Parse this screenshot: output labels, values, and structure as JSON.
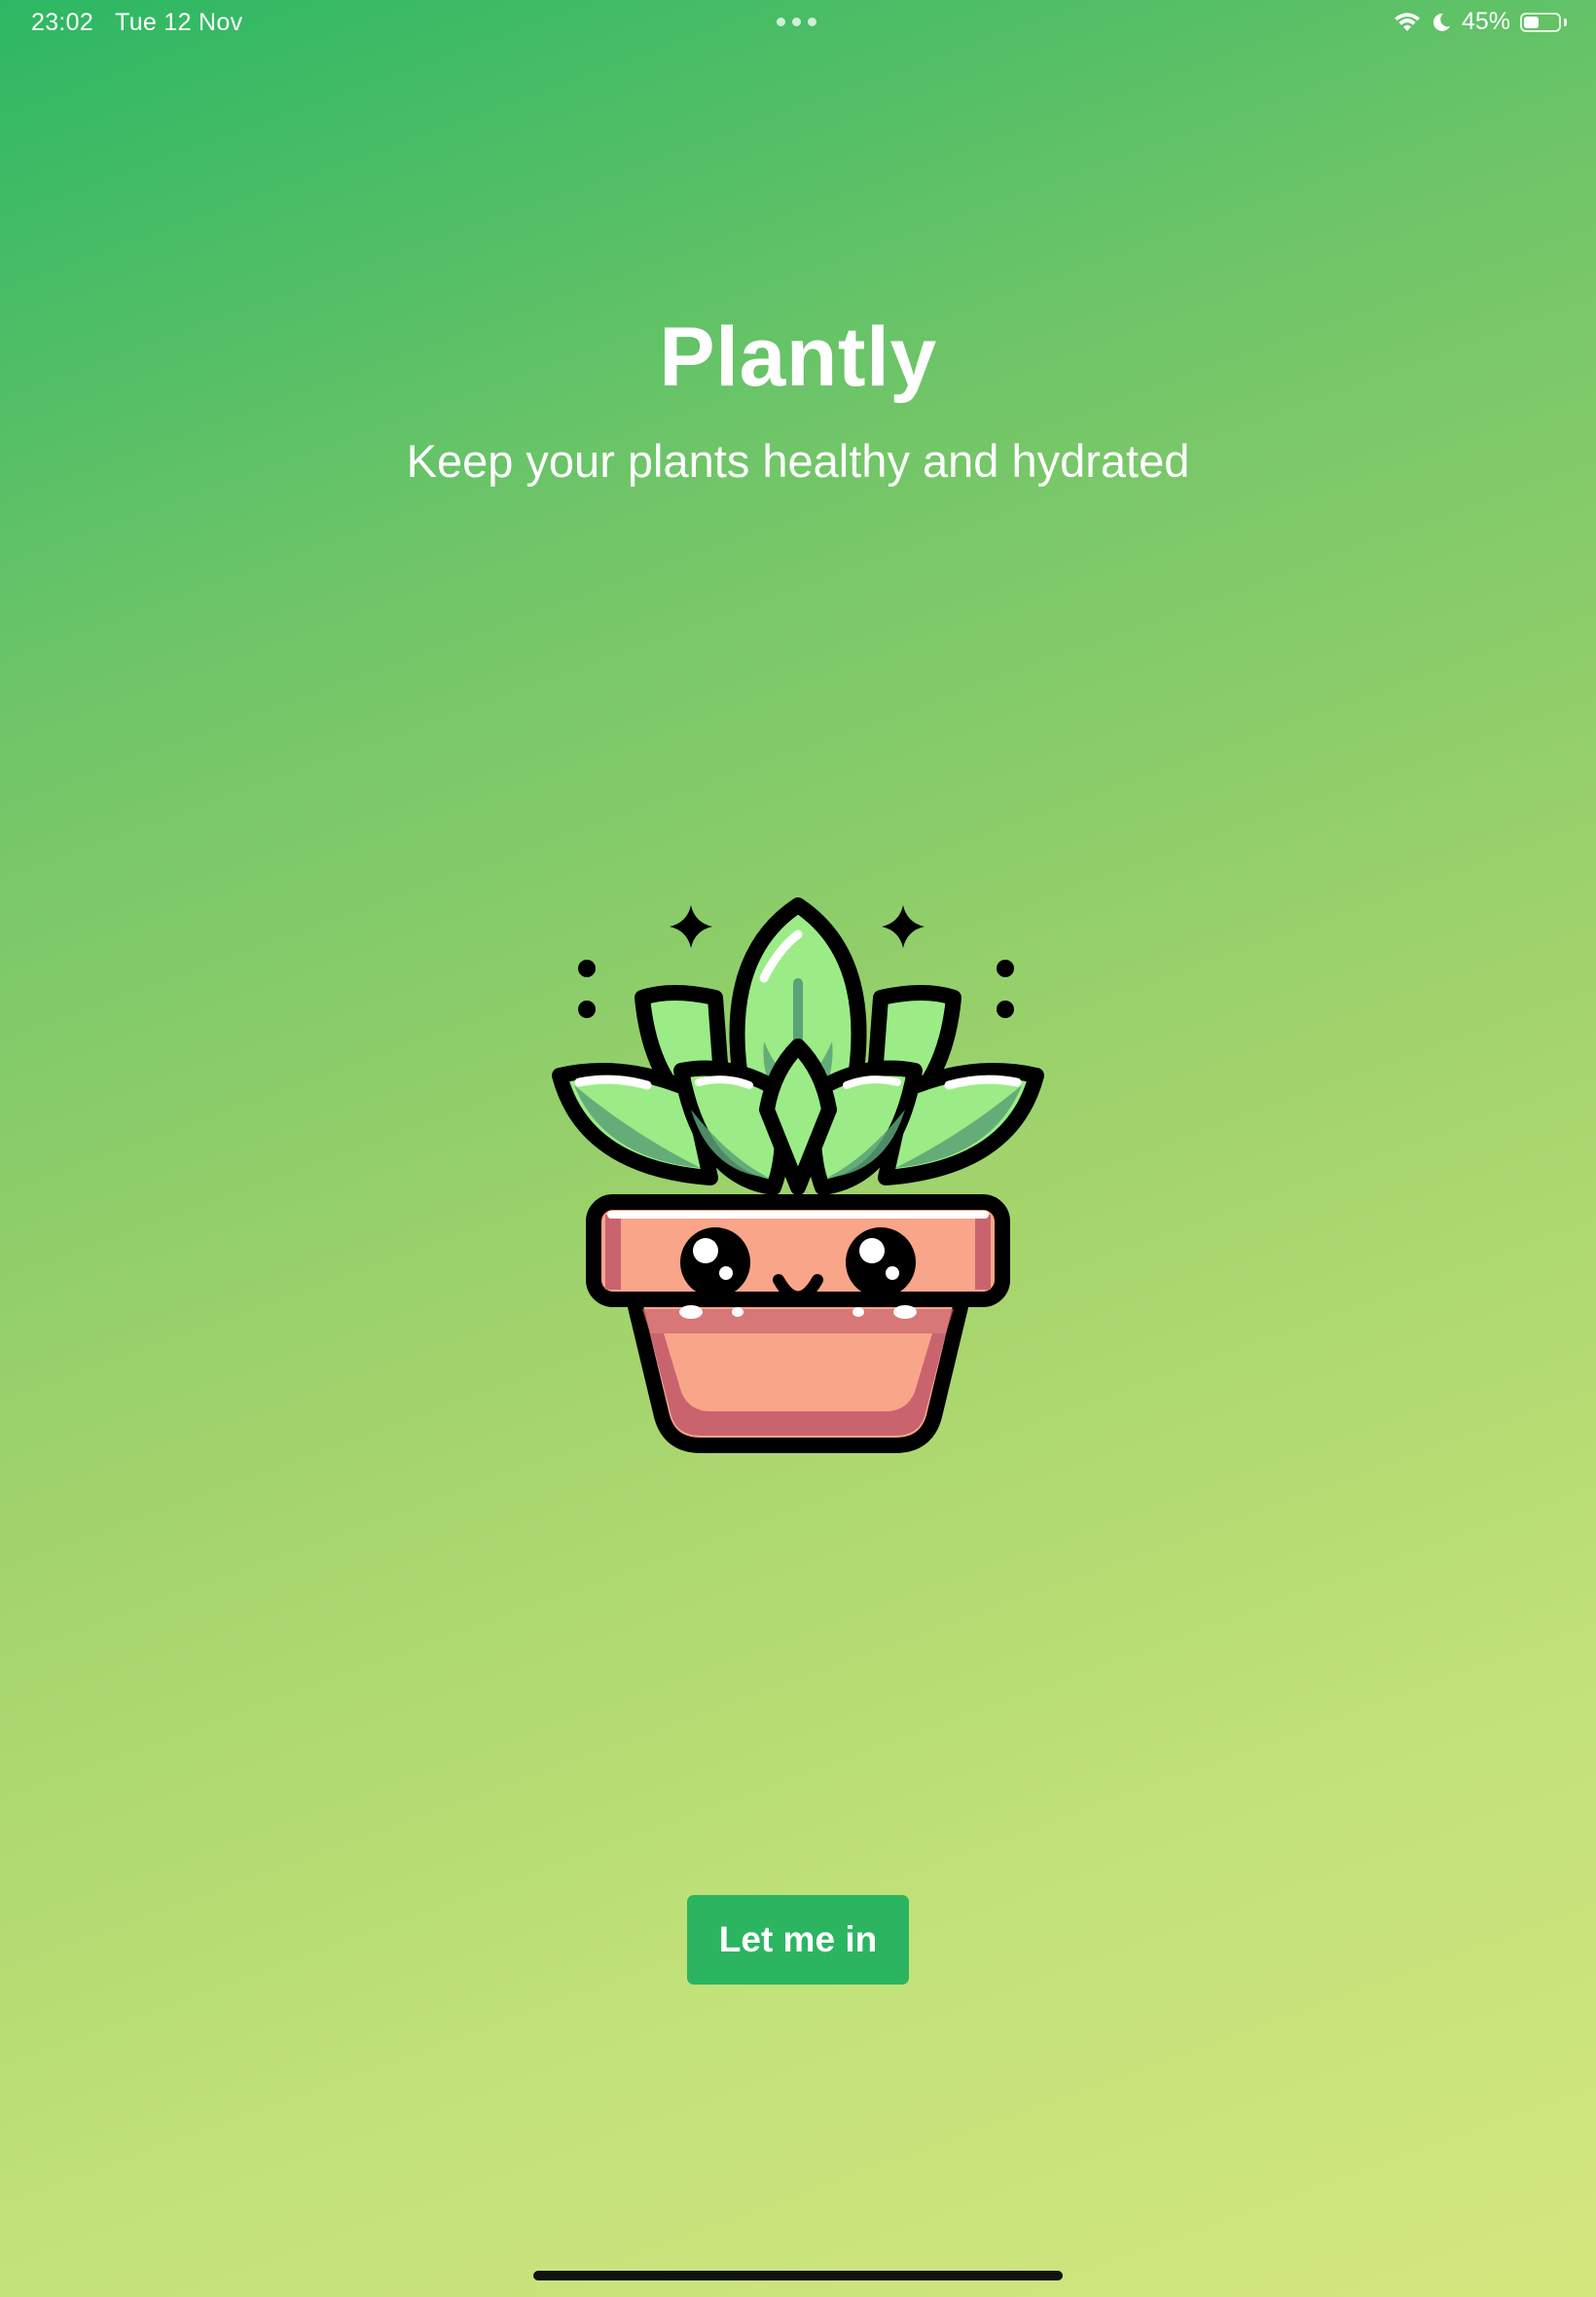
{
  "status_bar": {
    "time": "23:02",
    "date": "Tue 12 Nov",
    "battery_text": "45%",
    "battery_level": 0.45
  },
  "hero": {
    "title": "Plantly",
    "subtitle": "Keep your plants healthy and hydrated"
  },
  "mascot": {
    "icon": "potted-plant-mascot-icon"
  },
  "cta": {
    "label": "Let me in"
  },
  "colors": {
    "gradient_start": "#2db764",
    "gradient_end": "#d3e67e",
    "button": "#2bb561",
    "pot": "#f9a58a",
    "leaf": "#9bec86"
  }
}
